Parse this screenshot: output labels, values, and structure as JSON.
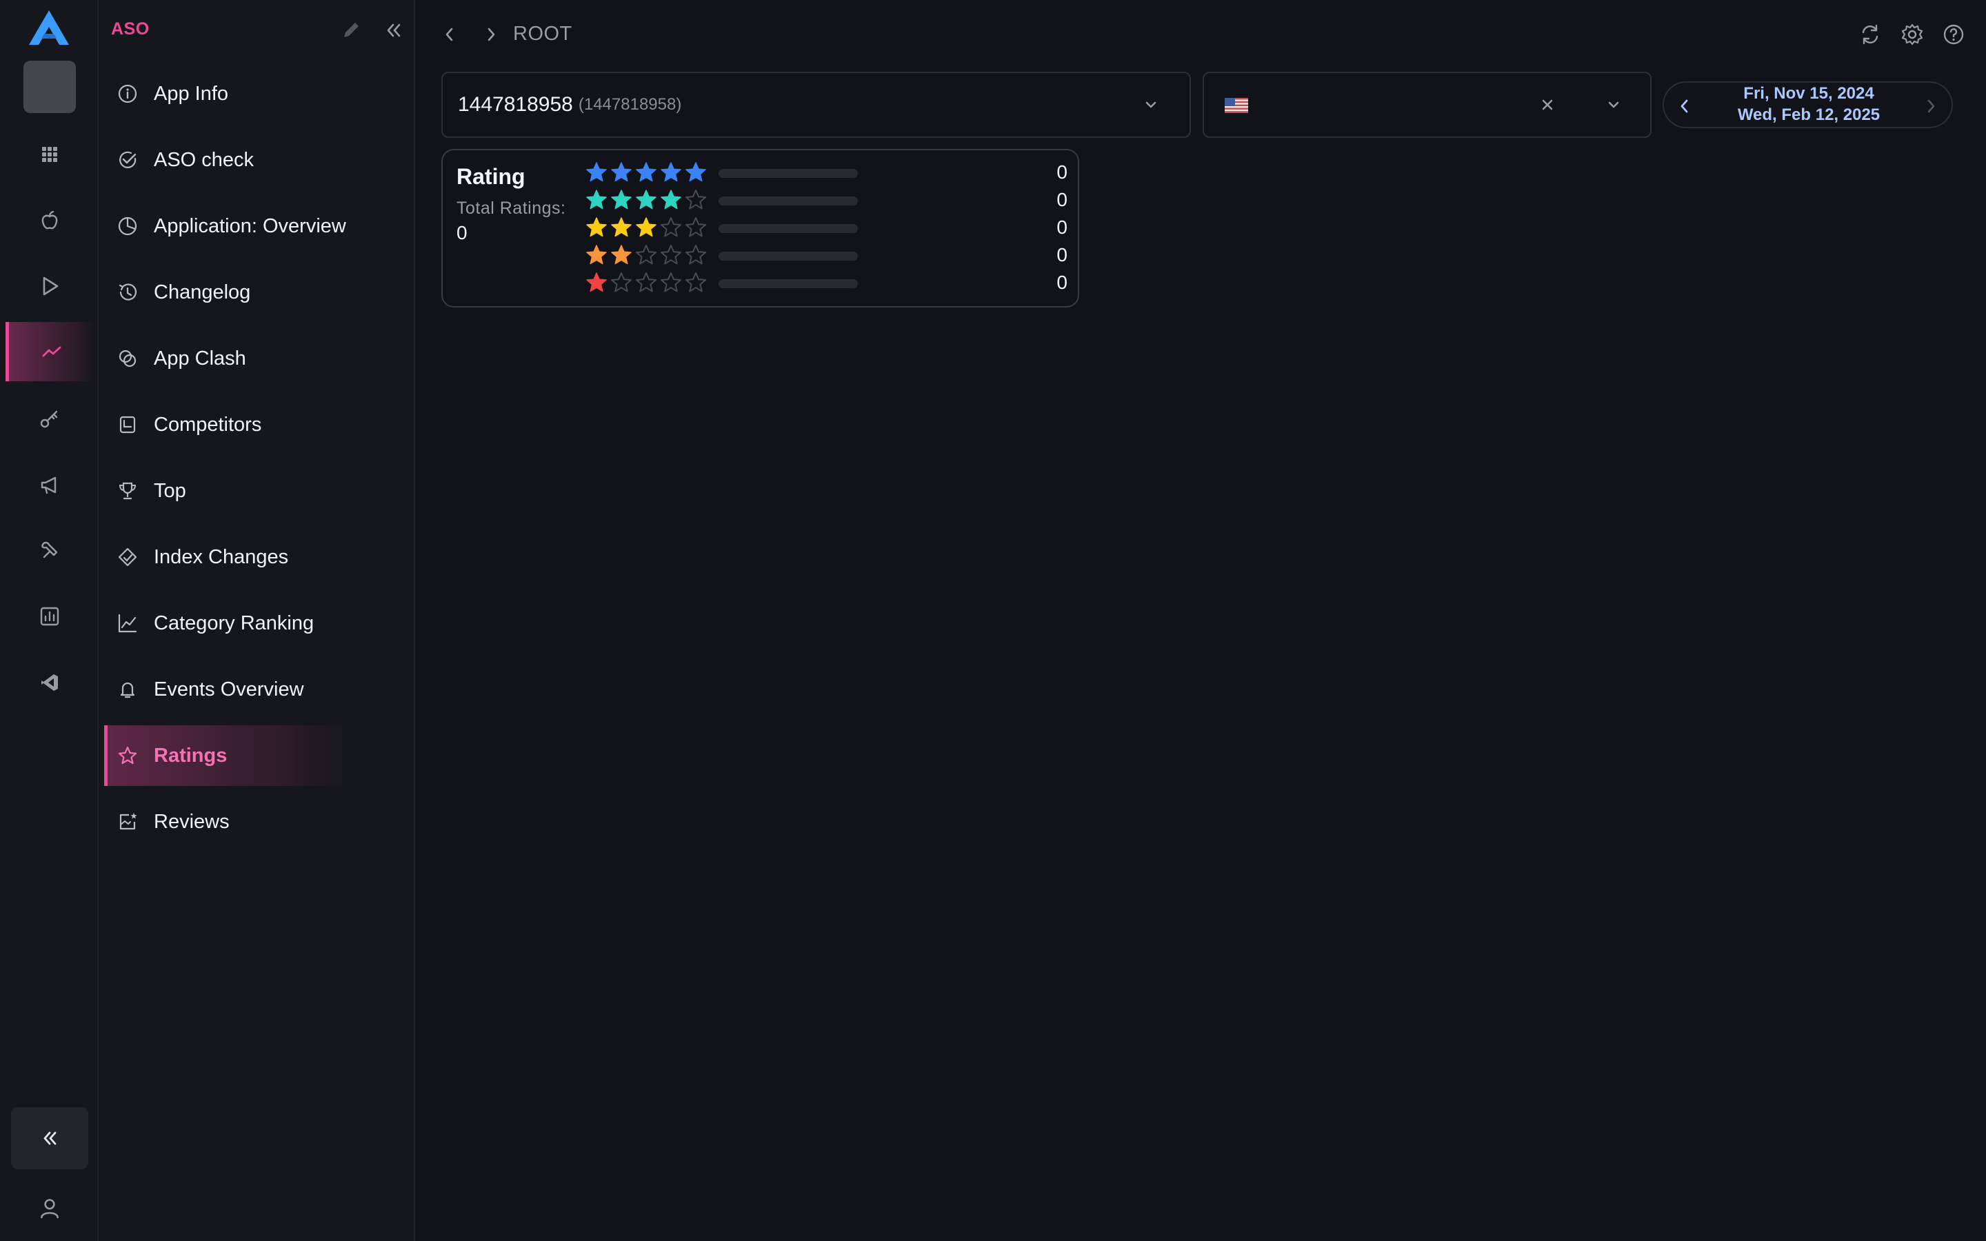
{
  "sidebar": {
    "title": "ASO",
    "items": [
      {
        "label": "App Info",
        "icon": "info-circle-icon"
      },
      {
        "label": "ASO check",
        "icon": "check-circle-icon"
      },
      {
        "label": "Application: Overview",
        "icon": "pie-chart-icon"
      },
      {
        "label": "Changelog",
        "icon": "history-icon"
      },
      {
        "label": "App Clash",
        "icon": "clash-circles-icon"
      },
      {
        "label": "Competitors",
        "icon": "competitors-icon"
      },
      {
        "label": "Top",
        "icon": "trophy-icon"
      },
      {
        "label": "Index Changes",
        "icon": "index-tag-icon"
      },
      {
        "label": "Category Ranking",
        "icon": "line-chart-icon"
      },
      {
        "label": "Events Overview",
        "icon": "bell-icon"
      },
      {
        "label": "Ratings",
        "icon": "star-icon",
        "active": true
      },
      {
        "label": "Reviews",
        "icon": "reviews-icon"
      }
    ]
  },
  "rail": {
    "items": [
      {
        "icon": "grid-icon"
      },
      {
        "icon": "apple-icon"
      },
      {
        "icon": "google-play-icon"
      },
      {
        "icon": "trend-icon",
        "active": true
      },
      {
        "icon": "key-icon"
      },
      {
        "icon": "megaphone-icon"
      },
      {
        "icon": "tools-icon"
      },
      {
        "icon": "bar-report-icon"
      },
      {
        "icon": "vscode-icon"
      }
    ]
  },
  "topbar": {
    "breadcrumb": "ROOT"
  },
  "filters": {
    "app": {
      "name": "1447818958",
      "id": "(1447818958)"
    },
    "country": {
      "flag": "US",
      "value": ""
    },
    "date_range": {
      "start": "Fri, Nov 15, 2024",
      "end": "Wed, Feb 12, 2025"
    }
  },
  "rating": {
    "title": "Rating",
    "total_label": "Total Ratings:",
    "total": "0",
    "rows": [
      {
        "stars": 5,
        "color": "#3b82f6",
        "count": "0",
        "share": 0
      },
      {
        "stars": 4,
        "color": "#2dd4bf",
        "count": "0",
        "share": 0
      },
      {
        "stars": 3,
        "color": "#facc15",
        "count": "0",
        "share": 0
      },
      {
        "stars": 2,
        "color": "#fb923c",
        "count": "0",
        "share": 0
      },
      {
        "stars": 1,
        "color": "#ef4444",
        "count": "0",
        "share": 0
      }
    ]
  },
  "colors": {
    "accent": "#ec4899",
    "background": "#121318",
    "sidebar": "#16171c"
  }
}
